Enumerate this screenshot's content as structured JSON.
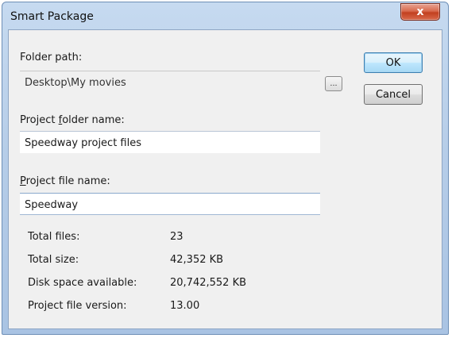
{
  "window": {
    "title": "Smart Package",
    "close_glyph": "x"
  },
  "folder_path": {
    "label": "Folder path:",
    "value": "Desktop\\My movies",
    "browse_label": "..."
  },
  "project_folder": {
    "label_pre": "Project ",
    "label_accel": "f",
    "label_post": "older name:",
    "value": "Speedway project files"
  },
  "project_file": {
    "label_accel": "P",
    "label_post": "roject file name:",
    "value": "Speedway"
  },
  "buttons": {
    "ok": "OK",
    "cancel": "Cancel"
  },
  "stats": {
    "total_files": {
      "label": "Total files:",
      "value": "23"
    },
    "total_size": {
      "label": "Total size:",
      "value": "42,352 KB"
    },
    "disk_space": {
      "label": "Disk space available:",
      "value": "20,742,552 KB"
    },
    "version": {
      "label": "Project file version:",
      "value": "13.00"
    }
  },
  "colors": {
    "titlebar": "#b6cde8",
    "close": "#c2401f",
    "default_button": "#bee6fd",
    "client": "#f0f0f0"
  }
}
